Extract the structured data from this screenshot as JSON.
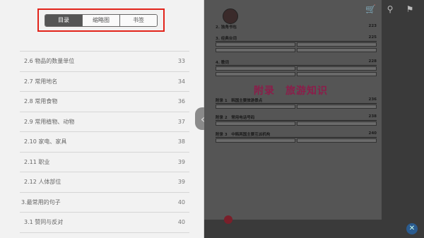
{
  "tabs": [
    {
      "label": "目录",
      "active": true
    },
    {
      "label": "缩略图",
      "active": false
    },
    {
      "label": "书签",
      "active": false
    }
  ],
  "toc": [
    {
      "label": "2.6 物品的数量单位",
      "page": "33",
      "type": "sub"
    },
    {
      "label": "2.7 常用地名",
      "page": "34",
      "type": "sub"
    },
    {
      "label": "2.8 常用食物",
      "page": "36",
      "type": "sub"
    },
    {
      "label": "2.9 常用植物、动物",
      "page": "37",
      "type": "sub"
    },
    {
      "label": "2.10 家电、家具",
      "page": "38",
      "type": "sub"
    },
    {
      "label": "2.11 职业",
      "page": "39",
      "type": "sub"
    },
    {
      "label": "2.12 人体部位",
      "page": "39",
      "type": "sub"
    },
    {
      "label": "3.最常用的句子",
      "page": "40",
      "type": "section"
    },
    {
      "label": "3.1 赞同与反对",
      "page": "40",
      "type": "sub"
    }
  ],
  "book": {
    "appendix_title": "附录　旅游知识",
    "lines": [
      {
        "text": "2. 独角书包",
        "page": "223",
        "bold": true
      },
      {
        "text": "3. 经典台词",
        "page": "225",
        "bold": true
      },
      {
        "text": "4. 歌词",
        "page": "228",
        "bold": true
      },
      {
        "text": "附录 1　韩国主要旅游景点",
        "page": "236",
        "bold": true
      },
      {
        "text": "附录 2　常用电话号码",
        "page": "238",
        "bold": true
      },
      {
        "text": "附录 3　中韩两国主要互派机构",
        "page": "240",
        "bold": true
      }
    ]
  },
  "icons": {
    "cart": "cart-icon",
    "search": "search-icon",
    "bookmark": "bookmark-icon",
    "close": "close-icon",
    "arrow": "chevron-left-icon"
  },
  "colors": {
    "highlight_border": "#e2231a",
    "appendix_title": "#8b1d4a",
    "active_tab": "#555555"
  }
}
